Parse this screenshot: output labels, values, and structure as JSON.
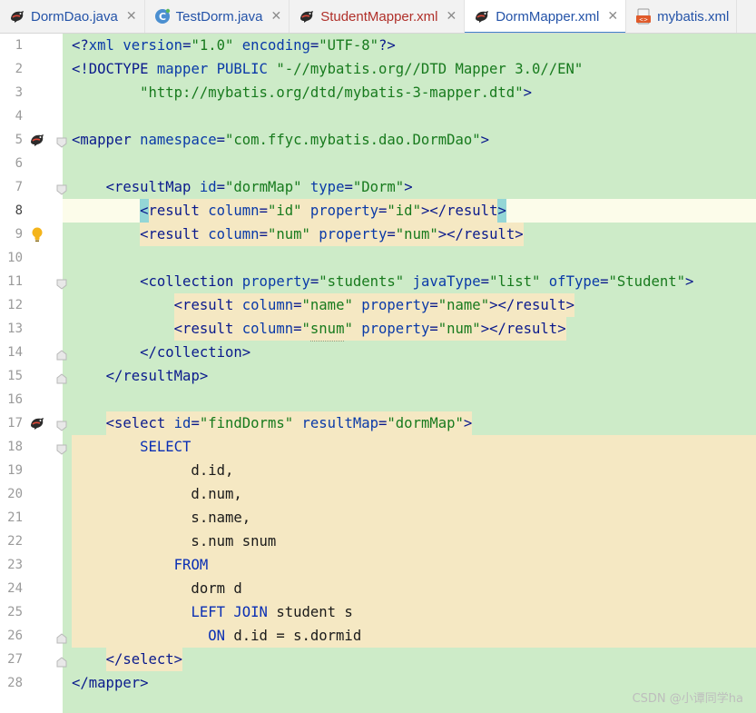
{
  "tabs": [
    {
      "label": "DormDao.java",
      "icon": "mybatis-bird-icon",
      "active": false,
      "color": "#2453a8",
      "closable": true
    },
    {
      "label": "TestDorm.java",
      "icon": "java-class-icon",
      "active": false,
      "color": "#2453a8",
      "closable": true
    },
    {
      "label": "StudentMapper.xml",
      "icon": "mybatis-bird-icon",
      "active": false,
      "color": "#b0302a",
      "closable": true
    },
    {
      "label": "DormMapper.xml",
      "icon": "mybatis-bird-icon",
      "active": true,
      "color": "#2453a8",
      "closable": true
    },
    {
      "label": "mybatis.xml",
      "icon": "xml-file-icon",
      "active": false,
      "color": "#2453a8",
      "closable": false
    }
  ],
  "close_glyph": "✕",
  "colors": {
    "editor_bg": "#cdebc8",
    "highlight_bg": "#f5e8c3",
    "brace_match": "#94d6d6",
    "active_tab_underline": "#4083c9"
  },
  "lines": [
    {
      "n": "1",
      "tokens": [
        {
          "c": "tg",
          "t": "<?"
        },
        {
          "c": "at",
          "t": "xml version"
        },
        {
          "c": "tg",
          "t": "="
        },
        {
          "c": "vl",
          "t": "\"1.0\""
        },
        {
          "c": "at",
          "t": " encoding"
        },
        {
          "c": "tg",
          "t": "="
        },
        {
          "c": "vl",
          "t": "\"UTF-8\""
        },
        {
          "c": "tg",
          "t": "?>"
        }
      ]
    },
    {
      "n": "2",
      "tokens": [
        {
          "c": "tg",
          "t": "<!DOCTYPE "
        },
        {
          "c": "at",
          "t": "mapper PUBLIC "
        },
        {
          "c": "vl",
          "t": "\"-//mybatis.org//DTD Mapper 3.0//EN\""
        }
      ]
    },
    {
      "n": "3",
      "tokens": [
        {
          "c": "tx",
          "t": "        "
        },
        {
          "c": "vl",
          "t": "\"http://mybatis.org/dtd/mybatis-3-mapper.dtd\""
        },
        {
          "c": "tg",
          "t": ">"
        }
      ]
    },
    {
      "n": "4",
      "tokens": []
    },
    {
      "n": "5",
      "mark": "mybatis-bird-icon",
      "fold": "open",
      "tokens": [
        {
          "c": "tg",
          "t": "<mapper "
        },
        {
          "c": "at",
          "t": "namespace"
        },
        {
          "c": "tg",
          "t": "="
        },
        {
          "c": "vl",
          "t": "\"com.ffyc.mybatis.dao.DormDao\""
        },
        {
          "c": "tg",
          "t": ">"
        }
      ]
    },
    {
      "n": "6",
      "tokens": []
    },
    {
      "n": "7",
      "fold": "open",
      "tokens": [
        {
          "c": "tx",
          "t": "    "
        },
        {
          "c": "tg",
          "t": "<resultMap "
        },
        {
          "c": "at",
          "t": "id"
        },
        {
          "c": "tg",
          "t": "="
        },
        {
          "c": "vl",
          "t": "\"dormMap\""
        },
        {
          "c": "at",
          "t": " type"
        },
        {
          "c": "tg",
          "t": "="
        },
        {
          "c": "vl",
          "t": "\"Dorm\""
        },
        {
          "c": "tg",
          "t": ">"
        }
      ]
    },
    {
      "n": "8",
      "current": true,
      "tokens": [
        {
          "c": "tx",
          "t": "        "
        },
        {
          "c": "tg bm",
          "t": "<"
        },
        {
          "c": "tg hl",
          "t": "result "
        },
        {
          "c": "at hl",
          "t": "column"
        },
        {
          "c": "tg hl",
          "t": "="
        },
        {
          "c": "vl hl",
          "t": "\"id\""
        },
        {
          "c": "at hl",
          "t": " property"
        },
        {
          "c": "tg hl",
          "t": "="
        },
        {
          "c": "vl hl",
          "t": "\"id\""
        },
        {
          "c": "tg hl",
          "t": "></result"
        },
        {
          "c": "tg bm",
          "t": ">"
        }
      ]
    },
    {
      "n": "9",
      "mark": "lightbulb-icon",
      "tokens": [
        {
          "c": "tx",
          "t": "        "
        },
        {
          "c": "tg hl",
          "t": "<result "
        },
        {
          "c": "at hl",
          "t": "column"
        },
        {
          "c": "tg hl",
          "t": "="
        },
        {
          "c": "vl hl",
          "t": "\"num\""
        },
        {
          "c": "at hl",
          "t": " property"
        },
        {
          "c": "tg hl",
          "t": "="
        },
        {
          "c": "vl hl",
          "t": "\"num\""
        },
        {
          "c": "tg hl",
          "t": "></result>"
        }
      ]
    },
    {
      "n": "10",
      "tokens": []
    },
    {
      "n": "11",
      "fold": "open",
      "tokens": [
        {
          "c": "tx",
          "t": "        "
        },
        {
          "c": "tg",
          "t": "<collection "
        },
        {
          "c": "at",
          "t": "property"
        },
        {
          "c": "tg",
          "t": "="
        },
        {
          "c": "vl",
          "t": "\"students\""
        },
        {
          "c": "at",
          "t": " javaType"
        },
        {
          "c": "tg",
          "t": "="
        },
        {
          "c": "vl",
          "t": "\"list\""
        },
        {
          "c": "at",
          "t": " ofType"
        },
        {
          "c": "tg",
          "t": "="
        },
        {
          "c": "vl",
          "t": "\"Student\""
        },
        {
          "c": "tg",
          "t": ">"
        }
      ]
    },
    {
      "n": "12",
      "tokens": [
        {
          "c": "tx",
          "t": "            "
        },
        {
          "c": "tg hl",
          "t": "<result "
        },
        {
          "c": "at hl",
          "t": "column"
        },
        {
          "c": "tg hl",
          "t": "="
        },
        {
          "c": "vl hl",
          "t": "\"name\""
        },
        {
          "c": "at hl",
          "t": " property"
        },
        {
          "c": "tg hl",
          "t": "="
        },
        {
          "c": "vl hl",
          "t": "\"name\""
        },
        {
          "c": "tg hl",
          "t": "></result>"
        }
      ]
    },
    {
      "n": "13",
      "tokens": [
        {
          "c": "tx",
          "t": "            "
        },
        {
          "c": "tg hl",
          "t": "<result "
        },
        {
          "c": "at hl",
          "t": "column"
        },
        {
          "c": "tg hl",
          "t": "="
        },
        {
          "c": "vl hl",
          "t": "\""
        },
        {
          "c": "vl hl sq",
          "t": "snum"
        },
        {
          "c": "vl hl",
          "t": "\""
        },
        {
          "c": "at hl",
          "t": " property"
        },
        {
          "c": "tg hl",
          "t": "="
        },
        {
          "c": "vl hl",
          "t": "\"num\""
        },
        {
          "c": "tg hl",
          "t": "></result>"
        }
      ]
    },
    {
      "n": "14",
      "fold": "close",
      "tokens": [
        {
          "c": "tx",
          "t": "        "
        },
        {
          "c": "tg",
          "t": "</collection>"
        }
      ]
    },
    {
      "n": "15",
      "fold": "close",
      "tokens": [
        {
          "c": "tx",
          "t": "    "
        },
        {
          "c": "tg",
          "t": "</resultMap>"
        }
      ]
    },
    {
      "n": "16",
      "tokens": []
    },
    {
      "n": "17",
      "mark": "mybatis-bird-icon",
      "fold": "open",
      "tokens": [
        {
          "c": "tx",
          "t": "    "
        },
        {
          "c": "tg hl",
          "t": "<select "
        },
        {
          "c": "at hl",
          "t": "id"
        },
        {
          "c": "tg hl",
          "t": "="
        },
        {
          "c": "vl hl",
          "t": "\"findDorms\""
        },
        {
          "c": "at hl",
          "t": " resultMap"
        },
        {
          "c": "tg hl",
          "t": "="
        },
        {
          "c": "vl hl",
          "t": "\"dormMap\""
        },
        {
          "c": "tg hl",
          "t": ">"
        }
      ]
    },
    {
      "n": "18",
      "block": true,
      "fold": "open",
      "tokens": [
        {
          "c": "tx",
          "t": "        "
        },
        {
          "c": "kw",
          "t": "SELECT"
        }
      ]
    },
    {
      "n": "19",
      "block": true,
      "tokens": [
        {
          "c": "tx",
          "t": "              d.id,"
        }
      ]
    },
    {
      "n": "20",
      "block": true,
      "tokens": [
        {
          "c": "tx",
          "t": "              d.num,"
        }
      ]
    },
    {
      "n": "21",
      "block": true,
      "tokens": [
        {
          "c": "tx",
          "t": "              s.name,"
        }
      ]
    },
    {
      "n": "22",
      "block": true,
      "tokens": [
        {
          "c": "tx",
          "t": "              s.num snum"
        }
      ]
    },
    {
      "n": "23",
      "block": true,
      "tokens": [
        {
          "c": "tx",
          "t": "            "
        },
        {
          "c": "kw",
          "t": "FROM"
        }
      ]
    },
    {
      "n": "24",
      "block": true,
      "tokens": [
        {
          "c": "tx",
          "t": "              dorm d"
        }
      ]
    },
    {
      "n": "25",
      "block": true,
      "tokens": [
        {
          "c": "tx",
          "t": "              "
        },
        {
          "c": "kw",
          "t": "LEFT JOIN"
        },
        {
          "c": "tx",
          "t": " student s"
        }
      ]
    },
    {
      "n": "26",
      "block": true,
      "fold": "close",
      "tokens": [
        {
          "c": "tx",
          "t": "                "
        },
        {
          "c": "kw",
          "t": "ON"
        },
        {
          "c": "tx",
          "t": " d.id = s.dormid"
        }
      ]
    },
    {
      "n": "27",
      "fold": "close",
      "tokens": [
        {
          "c": "tx",
          "t": "    "
        },
        {
          "c": "tg hl",
          "t": "</select>"
        }
      ]
    },
    {
      "n": "28",
      "tokens": [
        {
          "c": "tg",
          "t": "</mapper>"
        }
      ]
    }
  ],
  "watermark": "CSDN @小谭同学ha"
}
